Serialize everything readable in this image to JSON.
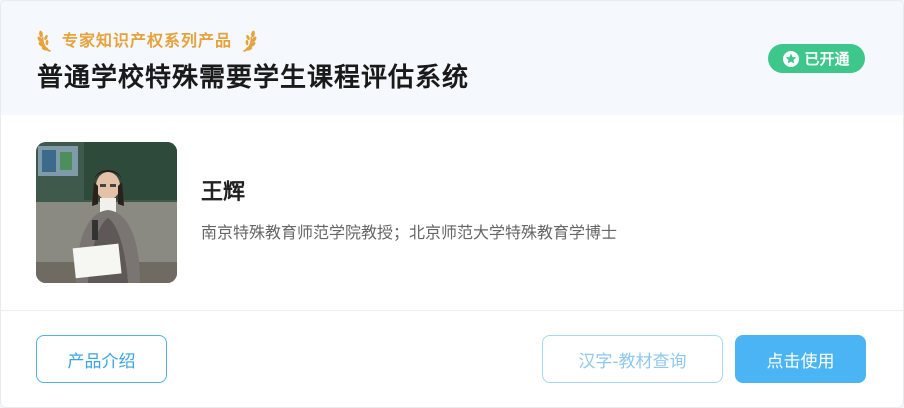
{
  "header": {
    "tagline": "专家知识产权系列产品",
    "title": "普通学校特殊需要学生课程评估系统",
    "status_badge": "已开通"
  },
  "expert": {
    "name": "王辉",
    "description": "南京特殊教育师范学院教授；北京师范大学特殊教育学博士"
  },
  "actions": {
    "intro_label": "产品介绍",
    "query_label": "汉字-教材查询",
    "use_label": "点击使用"
  },
  "icons": {
    "badge_icon": "star-icon",
    "tagline_icons": "laurel-icon"
  },
  "colors": {
    "accent_gold": "#e6a23c",
    "badge_green": "#3ec78b",
    "primary_blue": "#4ab4f5"
  }
}
